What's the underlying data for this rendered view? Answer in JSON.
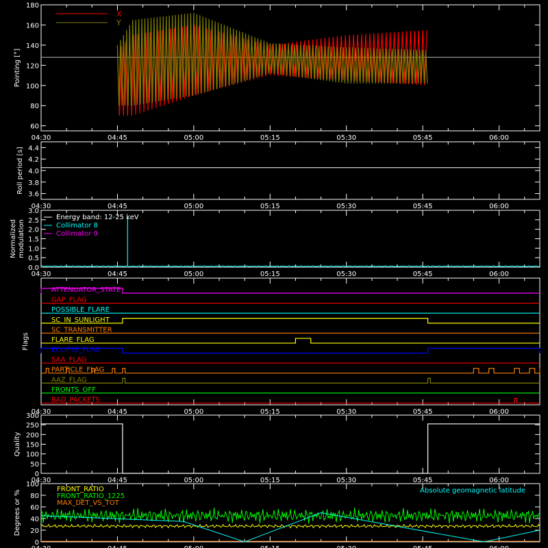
{
  "time_ticks": [
    "04:30",
    "04:45",
    "05:00",
    "05:15",
    "05:30",
    "05:45",
    "06:00"
  ],
  "colors": {
    "axis": "#ffffff",
    "x": "#ff0000",
    "y": "#808000",
    "cyan": "#00ffff",
    "magenta": "#ff00ff",
    "green": "#00ff00",
    "yellow": "#ffff00",
    "orange": "#ff8000",
    "blue": "#0000ff",
    "red": "#ff0000"
  },
  "chart_data": [
    {
      "type": "line",
      "ylabel": "Pointing [°]",
      "ylim": [
        55,
        180
      ],
      "yticks": [
        60,
        80,
        100,
        120,
        140,
        160,
        180
      ],
      "legend": [
        {
          "name": "X",
          "color": "#ff0000"
        },
        {
          "name": "Y",
          "color": "#808000"
        }
      ],
      "reference_line": 128,
      "data_start": "04:45",
      "data_end": "05:46",
      "x_envelope": {
        "times": [
          "04:45",
          "04:48",
          "05:00",
          "05:15",
          "05:30",
          "05:46"
        ],
        "upper": [
          135,
          150,
          160,
          140,
          150,
          155
        ],
        "lower": [
          70,
          70,
          90,
          110,
          105,
          100
        ]
      },
      "y_envelope": {
        "times": [
          "04:45",
          "04:48",
          "05:00",
          "05:15",
          "05:30",
          "05:46"
        ],
        "upper": [
          140,
          165,
          172,
          142,
          138,
          135
        ],
        "lower": [
          80,
          80,
          90,
          112,
          102,
          102
        ]
      }
    },
    {
      "type": "line",
      "ylabel": "Roll period [s]",
      "ylim": [
        3.5,
        4.5
      ],
      "yticks": [
        3.6,
        3.8,
        4.0,
        4.2,
        4.4
      ],
      "series": [
        {
          "value": 4.05,
          "color": "#ffffff"
        }
      ]
    },
    {
      "type": "line",
      "ylabel_lines": [
        "Normalized",
        "modulation"
      ],
      "ylim": [
        0,
        3.0
      ],
      "yticks": [
        0.0,
        0.5,
        1.0,
        1.5,
        2.0,
        2.5,
        3.0
      ],
      "legend": [
        {
          "name": "Energy band: 12-25 keV",
          "color": "#ffffff"
        },
        {
          "name": "Collimator 8",
          "color": "#00ffff"
        },
        {
          "name": "Collimator 9",
          "color": "#ff00ff"
        }
      ],
      "baseline": 0.05,
      "spike": {
        "time": "04:47",
        "value": 2.6
      }
    },
    {
      "type": "line",
      "ylabel": "Flags",
      "flags": [
        {
          "name": "ATTENUATOR_STATE",
          "color": "#ff00ff",
          "on": [
            [
              "04:30",
              "04:46"
            ]
          ]
        },
        {
          "name": "GAP_FLAG",
          "color": "#ff0000",
          "on": []
        },
        {
          "name": "POSSIBLE_FLARE",
          "color": "#00ffff",
          "on": []
        },
        {
          "name": "SC_IN_SUNLIGHT",
          "color": "#ffff00",
          "on": [
            [
              "04:46",
              "05:46"
            ]
          ]
        },
        {
          "name": "SC_TRANSMITTER",
          "color": "#ff8000",
          "on": []
        },
        {
          "name": "FLARE_FLAG",
          "color": "#ffff00",
          "on": [
            [
              "05:20",
              "05:23"
            ]
          ]
        },
        {
          "name": "ECLIPSE_FLAG",
          "color": "#0000ff",
          "on": [
            [
              "04:30",
              "04:46"
            ],
            [
              "05:46",
              "06:08"
            ]
          ]
        },
        {
          "name": "SAA_FLAG",
          "color": "#ff0000",
          "on": []
        },
        {
          "name": "PARTICLE_FLAG",
          "color": "#ff8000",
          "on": [
            [
              "04:31",
              "04:31.5"
            ],
            [
              "04:35",
              "04:35.5"
            ],
            [
              "04:40",
              "04:40.5"
            ],
            [
              "04:44",
              "04:44.5"
            ],
            [
              "04:46",
              "04:46.5"
            ],
            [
              "05:55",
              "05:56"
            ],
            [
              "05:58",
              "05:59"
            ],
            [
              "06:03",
              "06:04"
            ],
            [
              "06:06",
              "06:07"
            ],
            [
              "06:08",
              "06:08.5"
            ]
          ]
        },
        {
          "name": "AAZ_FLAG",
          "color": "#808000",
          "on": [
            [
              "04:46",
              "04:46.5"
            ],
            [
              "05:46",
              "05:46.5"
            ]
          ]
        },
        {
          "name": "FRONTS_OFF",
          "color": "#00ff00",
          "on": []
        },
        {
          "name": "BAD_PACKETS",
          "color": "#ff0000",
          "on": [
            [
              "06:03",
              "06:03.5"
            ]
          ]
        }
      ]
    },
    {
      "type": "line",
      "ylabel": "Quality",
      "ylim": [
        0,
        300
      ],
      "yticks": [
        0,
        50,
        100,
        150,
        200,
        250,
        300
      ],
      "segments": [
        {
          "from": "04:30",
          "to": "04:46",
          "value": 255
        },
        {
          "from": "04:46",
          "to": "05:46",
          "value": 0
        },
        {
          "from": "05:46",
          "to": "06:08",
          "value": 255
        }
      ],
      "color": "#ffffff"
    },
    {
      "type": "line",
      "ylabel": "Degrees or %",
      "ylim": [
        0,
        100
      ],
      "yticks": [
        0,
        20,
        40,
        60,
        80,
        100
      ],
      "legend": [
        {
          "name": "FRONT_RATIO",
          "color": "#ffff00"
        },
        {
          "name": "FRONT_RATIO_1225",
          "color": "#00ff00"
        },
        {
          "name": "MAX_DET_VS_TOT",
          "color": "#ff8000"
        }
      ],
      "right_label": {
        "name": "Absolute geomagnetic latitude",
        "color": "#00ffff"
      },
      "green_level": 45,
      "yellow_level": 27,
      "latitude": {
        "times": [
          "04:30",
          "04:58",
          "05:10",
          "05:25",
          "05:57",
          "06:08"
        ],
        "values": [
          45,
          35,
          0,
          50,
          0,
          20
        ]
      }
    }
  ]
}
